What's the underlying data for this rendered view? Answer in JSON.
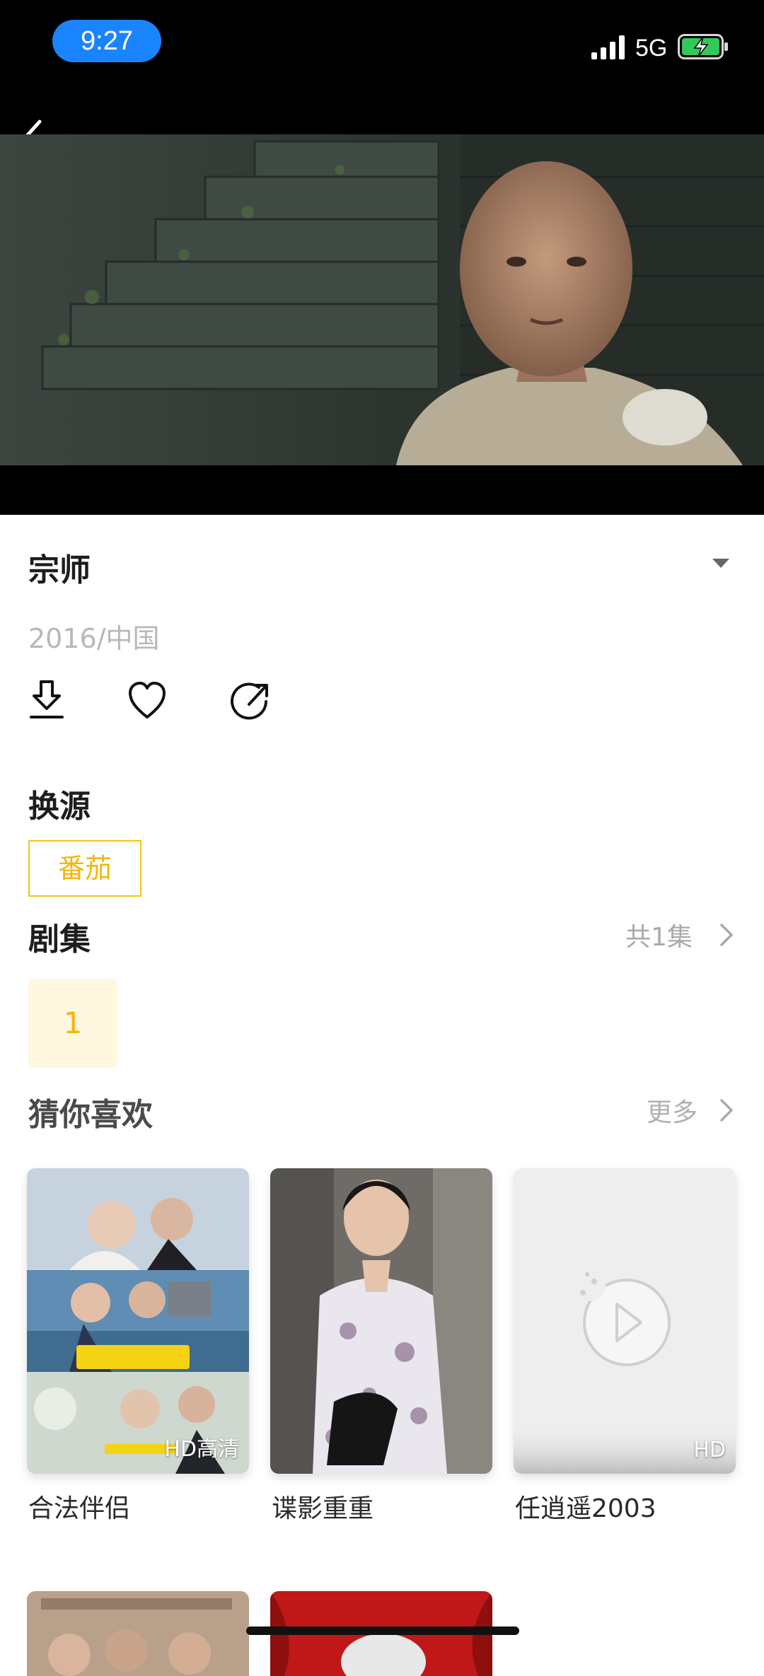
{
  "status_bar": {
    "time": "9:27",
    "network": "5G",
    "accent": "#1a84ff",
    "battery_charging": true
  },
  "header": {
    "back_icon": "chevron-left-icon"
  },
  "video": {
    "title": "宗师",
    "meta": "2016/中国",
    "collapse_icon": "caret-down-icon",
    "actions": [
      {
        "icon": "download-icon"
      },
      {
        "icon": "heart-icon"
      },
      {
        "icon": "share-icon"
      }
    ]
  },
  "source": {
    "title": "换源",
    "selected": "番茄",
    "accent": "#f5c518"
  },
  "episodes": {
    "title": "剧集",
    "count_label": "共1集",
    "items": [
      "1"
    ]
  },
  "recommendations": {
    "title": "猜你喜欢",
    "more_label": "更多",
    "items": [
      {
        "title": "合法伴侣",
        "badge": "HD高清"
      },
      {
        "title": "谍影重重",
        "badge": ""
      },
      {
        "title": "任逍遥2003",
        "badge": "HD"
      }
    ]
  }
}
